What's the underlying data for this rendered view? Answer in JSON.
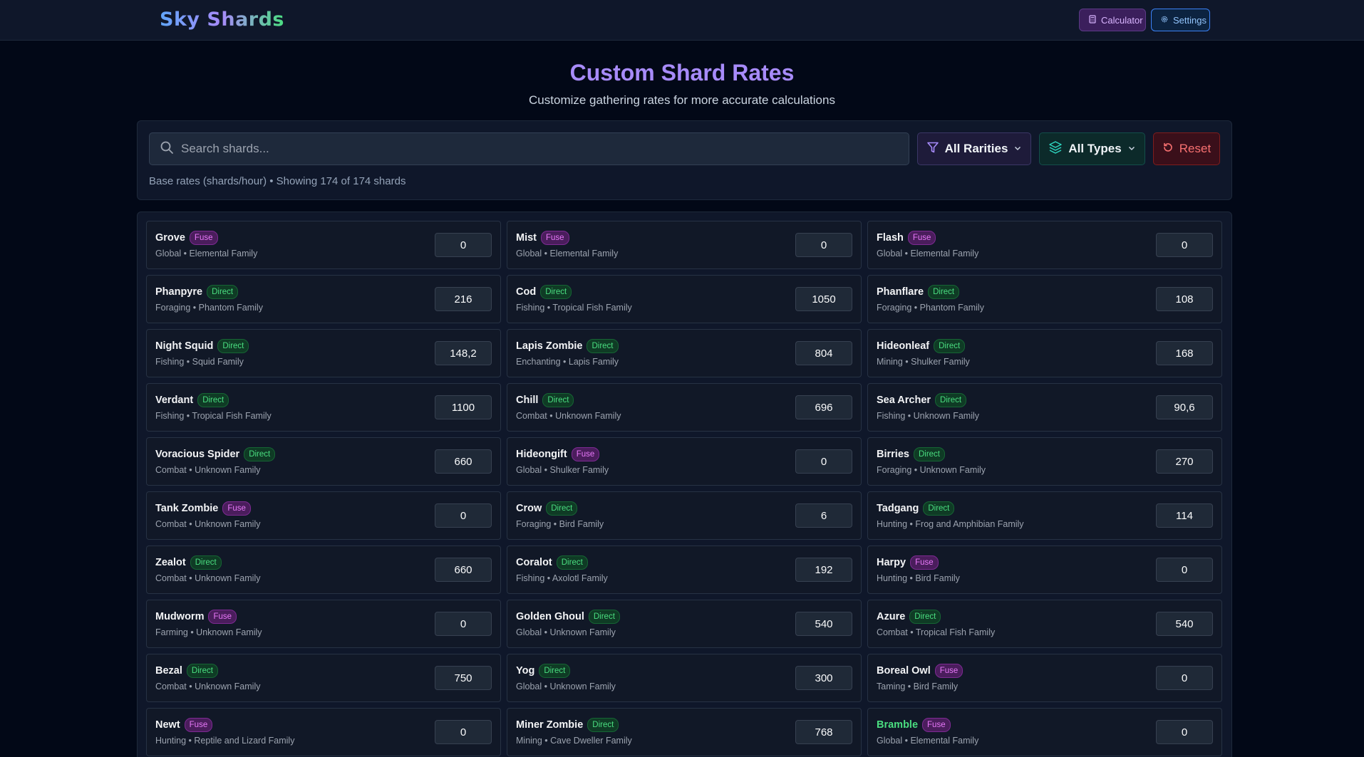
{
  "header": {
    "logo": "Sky Shards",
    "calculator_label": "Calculator",
    "settings_label": "Settings"
  },
  "page": {
    "title": "Custom Shard Rates",
    "subtitle": "Customize gathering rates for more accurate calculations"
  },
  "filters": {
    "search_placeholder": "Search shards...",
    "rarity_label": "All Rarities",
    "types_label": "All Types",
    "reset_label": "Reset",
    "info": "Base rates (shards/hour) • Showing 174 of 174 shards"
  },
  "colors": {
    "fuse": "#e879f9",
    "direct": "#4ade80",
    "accent": "#a78bfa"
  },
  "shards": [
    {
      "name": "Grove",
      "type": "Fuse",
      "meta": "Global • Elemental Family",
      "rate": "0"
    },
    {
      "name": "Mist",
      "type": "Fuse",
      "meta": "Global • Elemental Family",
      "rate": "0"
    },
    {
      "name": "Flash",
      "type": "Fuse",
      "meta": "Global • Elemental Family",
      "rate": "0"
    },
    {
      "name": "Phanpyre",
      "type": "Direct",
      "meta": "Foraging • Phantom Family",
      "rate": "216"
    },
    {
      "name": "Cod",
      "type": "Direct",
      "meta": "Fishing • Tropical Fish Family",
      "rate": "1050"
    },
    {
      "name": "Phanflare",
      "type": "Direct",
      "meta": "Foraging • Phantom Family",
      "rate": "108"
    },
    {
      "name": "Night Squid",
      "type": "Direct",
      "meta": "Fishing • Squid Family",
      "rate": "148,2"
    },
    {
      "name": "Lapis Zombie",
      "type": "Direct",
      "meta": "Enchanting • Lapis Family",
      "rate": "804"
    },
    {
      "name": "Hideonleaf",
      "type": "Direct",
      "meta": "Mining • Shulker Family",
      "rate": "168"
    },
    {
      "name": "Verdant",
      "type": "Direct",
      "meta": "Fishing • Tropical Fish Family",
      "rate": "1100"
    },
    {
      "name": "Chill",
      "type": "Direct",
      "meta": "Combat • Unknown Family",
      "rate": "696"
    },
    {
      "name": "Sea Archer",
      "type": "Direct",
      "meta": "Fishing • Unknown Family",
      "rate": "90,6"
    },
    {
      "name": "Voracious Spider",
      "type": "Direct",
      "meta": "Combat • Unknown Family",
      "rate": "660"
    },
    {
      "name": "Hideongift",
      "type": "Fuse",
      "meta": "Global • Shulker Family",
      "rate": "0"
    },
    {
      "name": "Birries",
      "type": "Direct",
      "meta": "Foraging • Unknown Family",
      "rate": "270"
    },
    {
      "name": "Tank Zombie",
      "type": "Fuse",
      "meta": "Combat • Unknown Family",
      "rate": "0"
    },
    {
      "name": "Crow",
      "type": "Direct",
      "meta": "Foraging • Bird Family",
      "rate": "6"
    },
    {
      "name": "Tadgang",
      "type": "Direct",
      "meta": "Hunting • Frog and Amphibian Family",
      "rate": "114"
    },
    {
      "name": "Zealot",
      "type": "Direct",
      "meta": "Combat • Unknown Family",
      "rate": "660"
    },
    {
      "name": "Coralot",
      "type": "Direct",
      "meta": "Fishing • Axolotl Family",
      "rate": "192"
    },
    {
      "name": "Harpy",
      "type": "Fuse",
      "meta": "Hunting • Bird Family",
      "rate": "0"
    },
    {
      "name": "Mudworm",
      "type": "Fuse",
      "meta": "Farming • Unknown Family",
      "rate": "0"
    },
    {
      "name": "Golden Ghoul",
      "type": "Direct",
      "meta": "Global • Unknown Family",
      "rate": "540"
    },
    {
      "name": "Azure",
      "type": "Direct",
      "meta": "Combat • Tropical Fish Family",
      "rate": "540"
    },
    {
      "name": "Bezal",
      "type": "Direct",
      "meta": "Combat • Unknown Family",
      "rate": "750"
    },
    {
      "name": "Yog",
      "type": "Direct",
      "meta": "Global • Unknown Family",
      "rate": "300"
    },
    {
      "name": "Boreal Owl",
      "type": "Fuse",
      "meta": "Taming • Bird Family",
      "rate": "0"
    },
    {
      "name": "Newt",
      "type": "Fuse",
      "meta": "Hunting • Reptile and Lizard Family",
      "rate": "0"
    },
    {
      "name": "Miner Zombie",
      "type": "Direct",
      "meta": "Mining • Cave Dweller Family",
      "rate": "768"
    },
    {
      "name": "Bramble",
      "type": "Fuse",
      "meta": "Global • Elemental Family",
      "rate": "0",
      "highlight": true
    }
  ]
}
